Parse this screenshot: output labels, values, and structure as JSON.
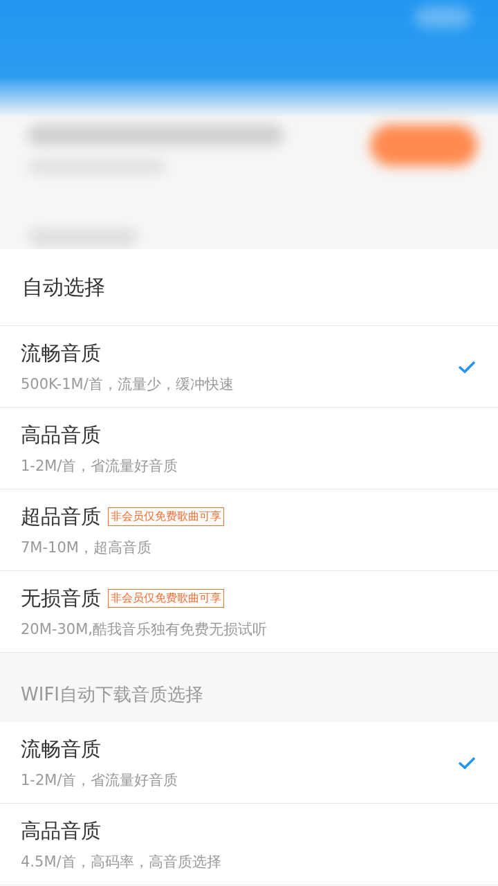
{
  "auto_select": {
    "label": "自动选择"
  },
  "stream_options": [
    {
      "title": "流畅音质",
      "subtitle": "500K-1M/首，流量少，缓冲快速",
      "selected": true
    },
    {
      "title": "高品音质",
      "subtitle": "1-2M/首，省流量好音质",
      "selected": false
    },
    {
      "title": "超品音质",
      "badge": "非会员仅免费歌曲可享",
      "subtitle": "7M-10M，超高音质",
      "selected": false
    },
    {
      "title": "无损音质",
      "badge": "非会员仅免费歌曲可享",
      "subtitle": "20M-30M,酷我音乐独有免费无损试听",
      "selected": false
    }
  ],
  "wifi_section": {
    "title": "WIFI自动下载音质选择",
    "options": [
      {
        "title": "流畅音质",
        "subtitle": "1-2M/首，省流量好音质",
        "selected": true
      },
      {
        "title": "高品音质",
        "subtitle": "4.5M/首，高码率，高音质选择",
        "selected": false
      }
    ]
  }
}
